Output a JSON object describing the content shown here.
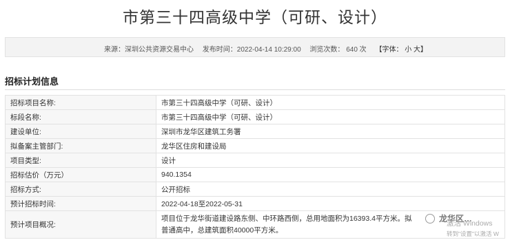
{
  "page_title": "市第三十四高级中学（可研、设计）",
  "meta": {
    "source": "来源：深圳公共资源交易中心",
    "publish_time": "发布时间：2022-04-14 10:29:00",
    "views": "浏览次数：  640  次",
    "font_size": "【字体：  小  大】"
  },
  "section_title": "招标计划信息",
  "rows": [
    {
      "label": "招标项目名称:",
      "value": "市第三十四高级中学（可研、设计）"
    },
    {
      "label": "标段名称:",
      "value": "市第三十四高级中学（可研、设计）"
    },
    {
      "label": "建设单位:",
      "value": "深圳市龙华区建筑工务署"
    },
    {
      "label": "拟备案主管部门:",
      "value": "龙华区住房和建设局"
    },
    {
      "label": "项目类型:",
      "value": "设计"
    },
    {
      "label": "招标估价（万元）",
      "value": "940.1354"
    },
    {
      "label": "招标方式:",
      "value": "公开招标"
    },
    {
      "label": "预计招标时间:",
      "value": "2022-04-18至2022-05-31"
    },
    {
      "label": "预计项目概况:",
      "value_line1": "项目位于龙华街道建设路东侧、中环路西侧，总用地面积为16393.4平方米。拟",
      "value_line2": "普通高中，总建筑面积40000平方米。"
    }
  ],
  "overlay": {
    "brand": "龙华区…",
    "activate_line1": "激活 Windows",
    "activate_line2": "转到\"设置\"以激活 W"
  }
}
